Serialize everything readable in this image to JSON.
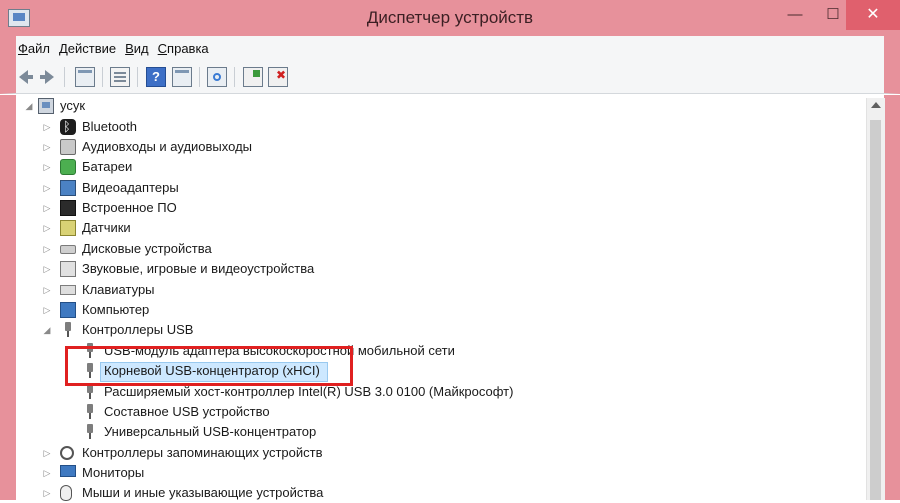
{
  "window": {
    "title": "Диспетчер устройств",
    "min_glyph": "—",
    "max_glyph": "☐",
    "close_glyph": "✕"
  },
  "menu": [
    {
      "label": "Файл",
      "accel": "Ф"
    },
    {
      "label": "Действие",
      "accel": "Д"
    },
    {
      "label": "Вид",
      "accel": "В"
    },
    {
      "label": "Справка",
      "accel": "С"
    }
  ],
  "toolbar": {
    "icons": [
      "back-arrow-icon",
      "forward-arrow-icon",
      "show-hide-console-tree-icon",
      "properties-icon",
      "help-icon",
      "action-pane-icon",
      "scan-hardware-icon",
      "update-driver-icon",
      "uninstall-device-icon"
    ]
  },
  "tree": {
    "root": {
      "label": "усук",
      "expanded": true,
      "icon": "computer-icon"
    },
    "items": [
      {
        "label": "Bluetooth",
        "icon": "bluetooth-icon",
        "expanded": false
      },
      {
        "label": "Аудиовходы и аудиовыходы",
        "icon": "audio-icon",
        "expanded": false
      },
      {
        "label": "Батареи",
        "icon": "battery-icon",
        "expanded": false
      },
      {
        "label": "Видеоадаптеры",
        "icon": "display-adapter-icon",
        "expanded": false
      },
      {
        "label": "Встроенное ПО",
        "icon": "firmware-icon",
        "expanded": false
      },
      {
        "label": "Датчики",
        "icon": "sensor-icon",
        "expanded": false
      },
      {
        "label": "Дисковые устройства",
        "icon": "disk-icon",
        "expanded": false
      },
      {
        "label": "Звуковые, игровые и видеоустройства",
        "icon": "sound-icon",
        "expanded": false
      },
      {
        "label": "Клавиатуры",
        "icon": "keyboard-icon",
        "expanded": false
      },
      {
        "label": "Компьютер",
        "icon": "pc-icon",
        "expanded": false
      },
      {
        "label": "Контроллеры USB",
        "icon": "usb-icon",
        "expanded": true
      }
    ],
    "usb_children": [
      {
        "label": "USB-модуль адаптера высокоскоростной мобильной сети"
      },
      {
        "label": "Корневой USB-концентратор (xHCI)",
        "selected": true
      },
      {
        "label": "Расширяемый хост-контроллер Intel(R) USB 3.0 0100 (Майкрософт)"
      },
      {
        "label": "Составное USB устройство"
      },
      {
        "label": "Универсальный USB-концентратор"
      }
    ],
    "after": [
      {
        "label": "Контроллеры запоминающих устройств",
        "icon": "storage-controller-icon",
        "expanded": false
      },
      {
        "label": "Мониторы",
        "icon": "monitor-icon",
        "expanded": false
      },
      {
        "label": "Мыши и иные указывающие устройства",
        "icon": "mouse-icon",
        "expanded": false
      }
    ]
  },
  "glyphs": {
    "collapsed": "▷",
    "expanded": "◢"
  },
  "colors": {
    "title_bar": "#e7919b",
    "close_button": "#e0606d",
    "selection": "#cde8ff",
    "annotation_box": "#e02020"
  }
}
